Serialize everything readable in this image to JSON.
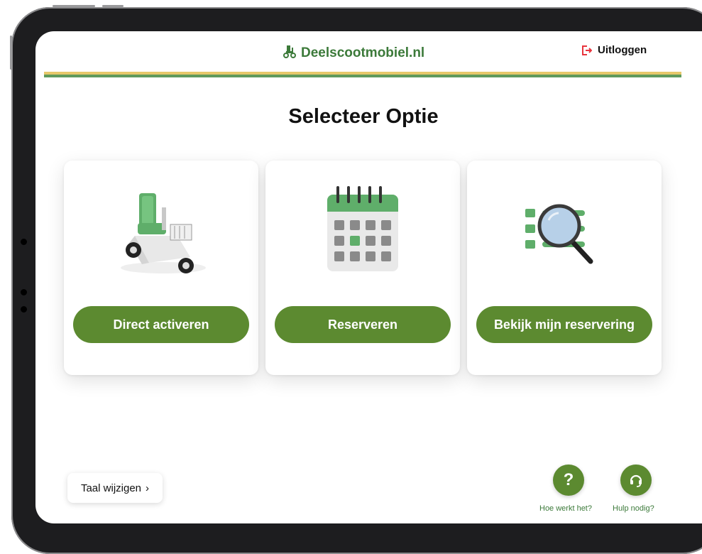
{
  "header": {
    "brand": "Deelscootmobiel.nl",
    "logout_label": "Uitloggen"
  },
  "page": {
    "title": "Selecteer Optie"
  },
  "options": [
    {
      "label": "Direct activeren",
      "icon": "mobility-scooter-icon"
    },
    {
      "label": "Reserveren",
      "icon": "calendar-icon"
    },
    {
      "label": "Bekijk mijn reservering",
      "icon": "search-list-icon"
    }
  ],
  "footer": {
    "language_label": "Taal wijzigen",
    "how_it_works_label": "Hoe werkt het?",
    "help_label": "Hulp nodig?"
  },
  "colors": {
    "brand_green": "#3c7a3a",
    "button_green": "#5c8a30",
    "stripe_yellow": "#e6c86a",
    "stripe_green": "#5f9a5c",
    "logout_red": "#e8343d"
  }
}
